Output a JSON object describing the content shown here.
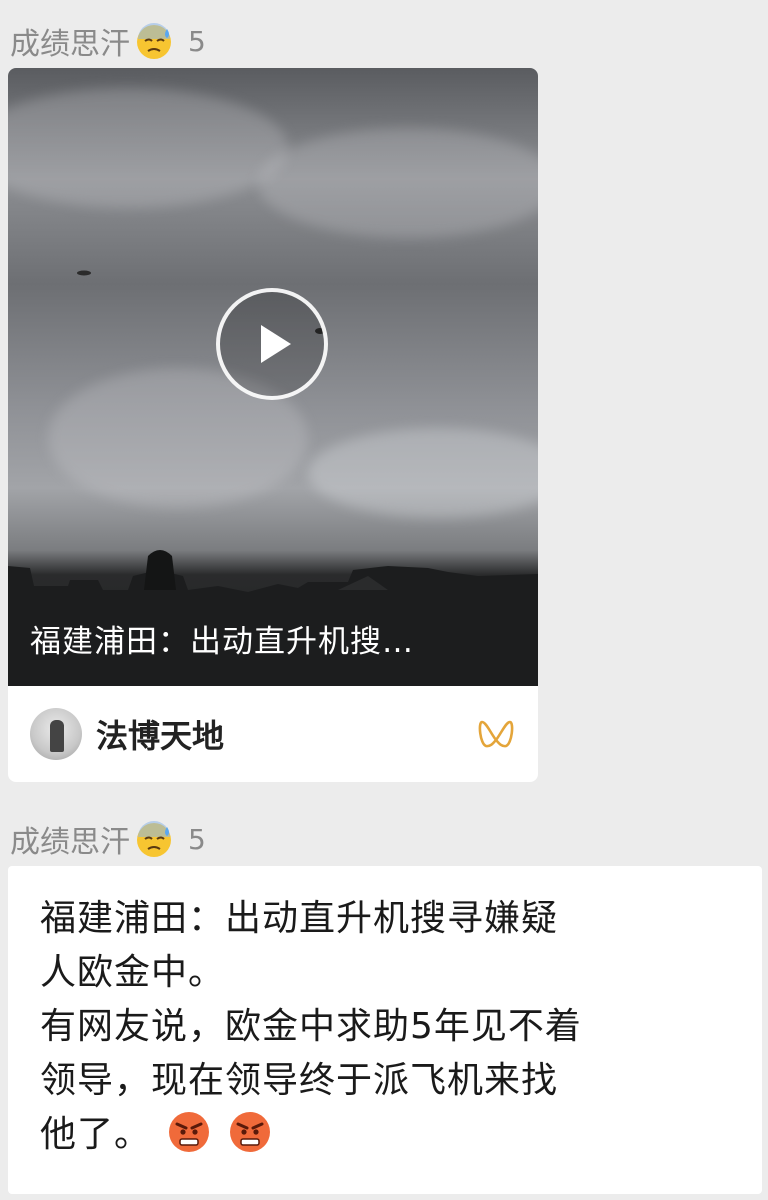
{
  "messages": [
    {
      "sender_name": "成绩思汗",
      "sender_emoji": "sweat-face",
      "sender_count": "5",
      "type": "video-card",
      "video_caption": "福建浦田：出动直升机搜…",
      "account_name": "法博天地"
    },
    {
      "sender_name": "成绩思汗",
      "sender_emoji": "sweat-face",
      "sender_count": "5",
      "type": "text",
      "lines": [
        "福建浦田：出动直升机搜寻嫌疑",
        "人欧金中。",
        "有网友说，欧金中求助5年见不着",
        "领导，现在领导终于派飞机来找",
        "他了。"
      ],
      "trailing_emojis": [
        "angry-face",
        "angry-face"
      ]
    }
  ]
}
